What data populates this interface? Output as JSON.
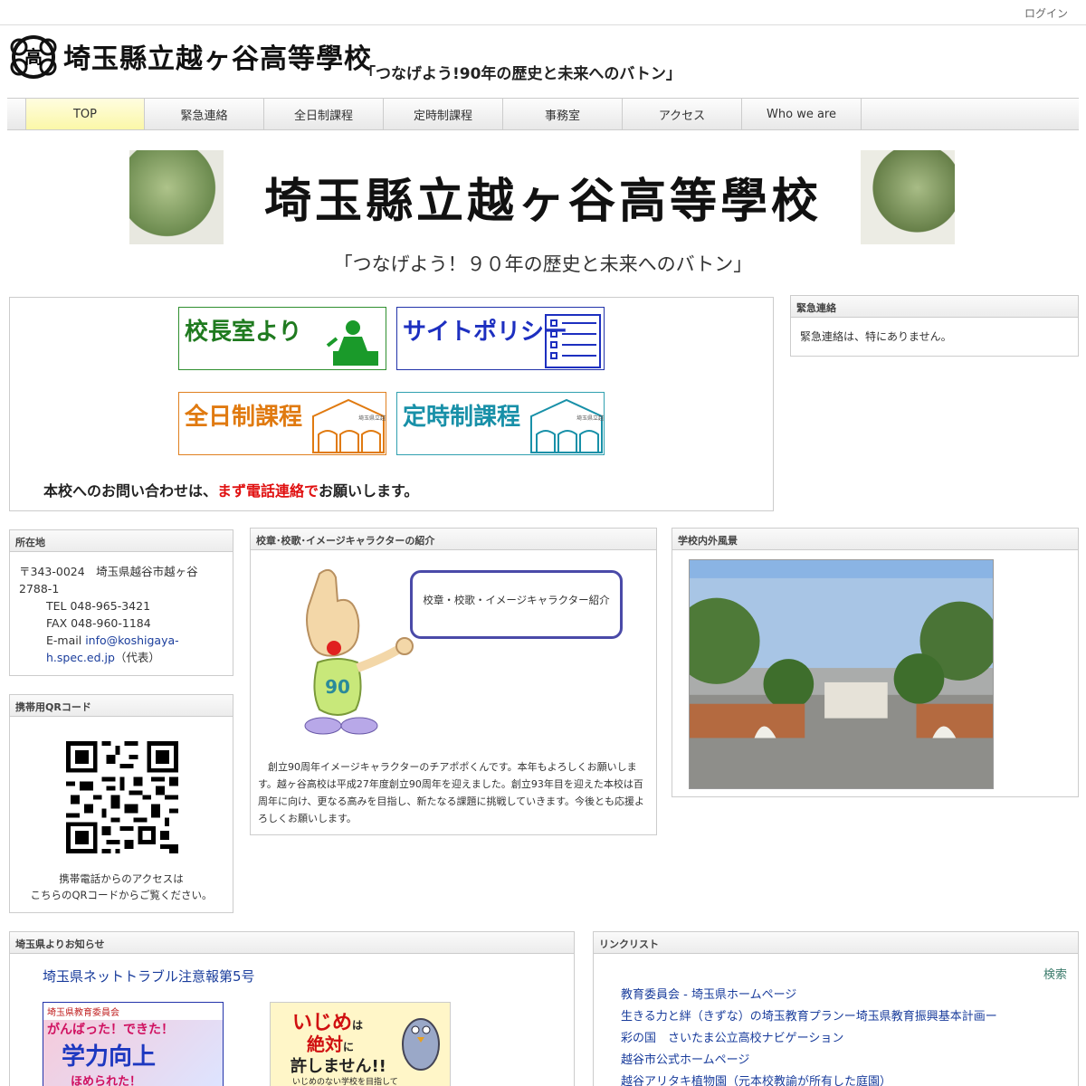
{
  "header": {
    "login_label": "ログイン",
    "school_name": "埼玉縣立越ヶ谷高等學校",
    "slogan": "「つなげよう!90年の歴史と未来へのバトン」"
  },
  "nav": {
    "items": [
      "TOP",
      "緊急連絡",
      "全日制課程",
      "定時制課程",
      "事務室",
      "アクセス",
      "Who we are"
    ],
    "active": "TOP"
  },
  "banner": {
    "title": "埼玉縣立越ヶ谷高等學校",
    "caption": "「つなげよう！９０年の歴史と未来へのバトン」"
  },
  "main": {
    "tiles": {
      "principal": "校長室より",
      "policy": "サイトポリシー",
      "fulltime": "全日制課程",
      "parttime": "定時制課程",
      "building_label": "埼玉県立越ヶ谷"
    },
    "notice_before": "本校へのお問い合わせは、",
    "notice_highlight": "まず電話連絡で",
    "notice_after": "お願いします。"
  },
  "emergency": {
    "title": "緊急連絡",
    "body": "緊急連絡は、特にありません。"
  },
  "address": {
    "title": "所在地",
    "postal": "〒343-0024　埼玉県越谷市越ヶ谷2788-1",
    "tel": "TEL 048-965-3421",
    "fax": "FAX 048-960-1184",
    "email_label": "E-mail",
    "email": "info@koshigaya-h.spec.ed.jp",
    "email_suffix": "（代表）"
  },
  "qr": {
    "title": "携帯用QRコード",
    "caption_line1": "携帯電話からのアクセスは",
    "caption_line2": "こちらのQRコードからご覧ください。"
  },
  "character": {
    "title": "校章･校歌･イメージキャラクターの紹介",
    "speech": "校章・校歌・イメージキャラクター紹介",
    "shirt_number": "90",
    "text": "　創立90周年イメージキャラクターのチアポポくんです。本年もよろしくお願いします。越ヶ谷高校は平成27年度創立90周年を迎えました。創立93年目を迎えた本校は百周年に向け、更なる高みを目指し、新たなる課題に挑戦していきます。今後とも応援よろしくお願いします。"
  },
  "scenery": {
    "title": "学校内外風景"
  },
  "prefecture": {
    "title": "埼玉県よりお知らせ",
    "link": "埼玉県ネットトラブル注意報第5号",
    "poster1_org": "埼玉県教育委員会",
    "poster1_line1": "がんばった！できた！",
    "poster1_big": "学力向上",
    "poster1_line2": "ほめられた！",
    "poster2_text1": "いじめ",
    "poster2_text2": "は",
    "poster2_text3": "絶対",
    "poster2_text4": "に",
    "poster2_text5": "許しません!!",
    "poster2_text6": "いじめのない学校を目指して"
  },
  "links": {
    "title": "リンクリスト",
    "search": "検索",
    "items": [
      "教育委員会 - 埼玉県ホームページ",
      "生きる力と絆（きずな）の埼玉教育プランー埼玉県教育振興基本計画ー",
      "彩の国　さいたま公立高校ナビゲーション",
      "越谷市公式ホームページ",
      "越谷アリタキ植物園（元本校教諭が所有した庭園）"
    ]
  },
  "colors": {
    "nav_active": "#fbf7a8",
    "link": "#1a3d9c",
    "notice_red": "#e01010"
  }
}
